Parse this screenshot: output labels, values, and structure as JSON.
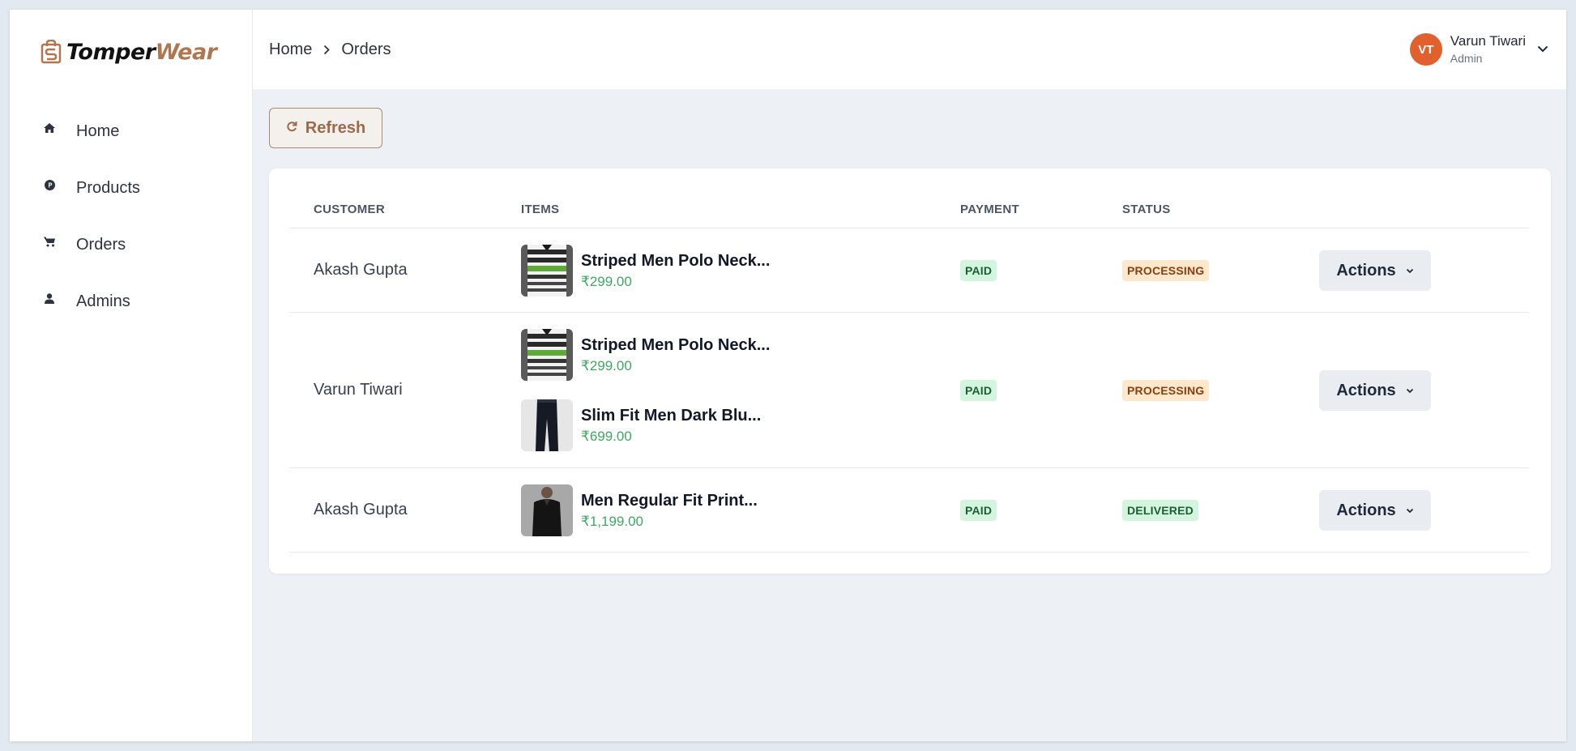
{
  "brand": {
    "part1": "Tomper",
    "part2": "Wear"
  },
  "sidebar": {
    "items": [
      {
        "label": "Home",
        "icon": "home-icon"
      },
      {
        "label": "Products",
        "icon": "products-icon"
      },
      {
        "label": "Orders",
        "icon": "cart-icon"
      },
      {
        "label": "Admins",
        "icon": "user-icon"
      }
    ]
  },
  "breadcrumb": {
    "home": "Home",
    "current": "Orders"
  },
  "user": {
    "initials": "VT",
    "name": "Varun Tiwari",
    "role": "Admin"
  },
  "toolbar": {
    "refresh_label": "Refresh"
  },
  "table": {
    "headers": {
      "customer": "CUSTOMER",
      "items": "ITEMS",
      "payment": "PAYMENT",
      "status": "STATUS"
    },
    "actions_label": "Actions",
    "rows": [
      {
        "customer": "Akash Gupta",
        "items": [
          {
            "name": "Striped Men Polo Neck...",
            "price": "₹299.00",
            "thumb": "striped-polo"
          }
        ],
        "payment": "PAID",
        "status": "PROCESSING"
      },
      {
        "customer": "Varun Tiwari",
        "items": [
          {
            "name": "Striped Men Polo Neck...",
            "price": "₹299.00",
            "thumb": "striped-polo"
          },
          {
            "name": "Slim Fit Men Dark Blu...",
            "price": "₹699.00",
            "thumb": "dark-jeans"
          }
        ],
        "payment": "PAID",
        "status": "PROCESSING"
      },
      {
        "customer": "Akash Gupta",
        "items": [
          {
            "name": "Men Regular Fit Print...",
            "price": "₹1,199.00",
            "thumb": "black-shirt"
          }
        ],
        "payment": "PAID",
        "status": "DELIVERED"
      }
    ]
  },
  "colors": {
    "accent": "#b0764f",
    "avatar": "#e0602e",
    "price": "#3fa862",
    "paid_bg": "#d4f5dd",
    "processing_bg": "#fde8cc"
  }
}
